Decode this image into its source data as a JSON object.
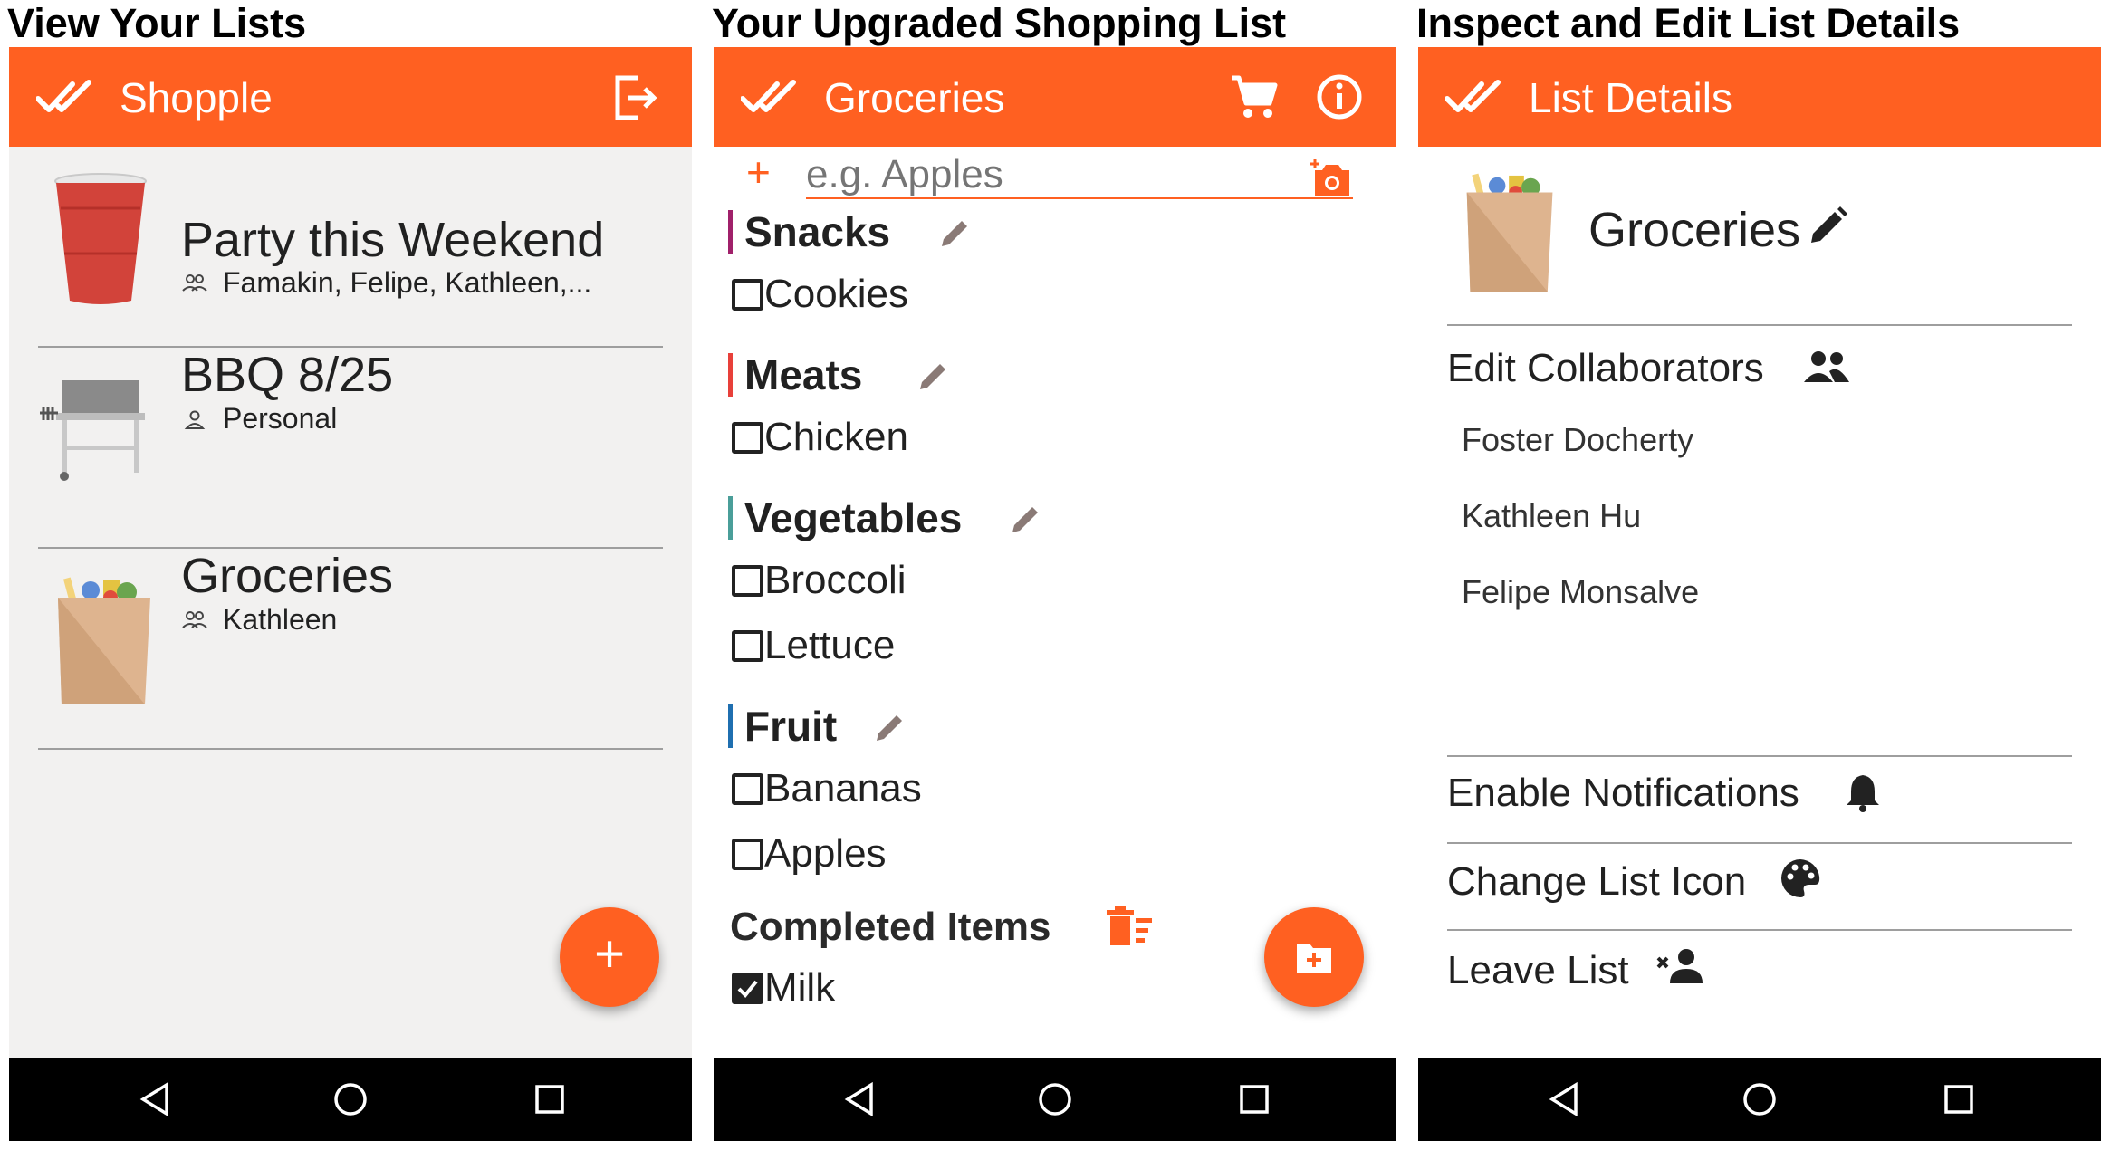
{
  "captions": [
    "View Your Lists",
    "Your Upgraded Shopping List",
    "Inspect and Edit List Details"
  ],
  "colors": {
    "appbar": "#FF6021",
    "navbar": "#000000",
    "list_bg": "#F2F1F0",
    "snacks": "#A0206A",
    "meats": "#E8403A",
    "vegetables": "#4A9E99",
    "fruit": "#1F6FB0"
  },
  "panel1": {
    "app_title": "Shopple",
    "lists": [
      {
        "title": "Party this Weekend",
        "members": "Famakin, Felipe, Kathleen,...",
        "members_icon": "group-icon",
        "icon": "red-cup-icon"
      },
      {
        "title": "BBQ 8/25",
        "members": "Personal",
        "members_icon": "person-icon",
        "icon": "grill-icon"
      },
      {
        "title": "Groceries",
        "members": "Kathleen",
        "members_icon": "group-icon",
        "icon": "grocery-bag-icon"
      }
    ],
    "fab": "+"
  },
  "panel2": {
    "app_title": "Groceries",
    "add_placeholder": "e.g. Apples",
    "add_symbol": "+",
    "categories": [
      {
        "name": "Snacks",
        "items": [
          "Cookies"
        ]
      },
      {
        "name": "Meats",
        "items": [
          "Chicken"
        ]
      },
      {
        "name": "Vegetables",
        "items": [
          "Broccoli",
          "Lettuce"
        ]
      },
      {
        "name": "Fruit",
        "items": [
          "Bananas",
          "Apples"
        ]
      }
    ],
    "completed_label": "Completed Items",
    "completed_items": [
      "Milk"
    ]
  },
  "panel3": {
    "app_title": "List Details",
    "list_name": "Groceries",
    "edit_collaborators": "Edit Collaborators",
    "collaborators": [
      "Foster Docherty",
      "Kathleen Hu",
      "Felipe Monsalve"
    ],
    "actions": [
      {
        "label": "Enable Notifications",
        "icon": "bell-icon"
      },
      {
        "label": "Change List Icon",
        "icon": "palette-icon"
      },
      {
        "label": "Leave List",
        "icon": "remove-person-icon"
      }
    ]
  }
}
